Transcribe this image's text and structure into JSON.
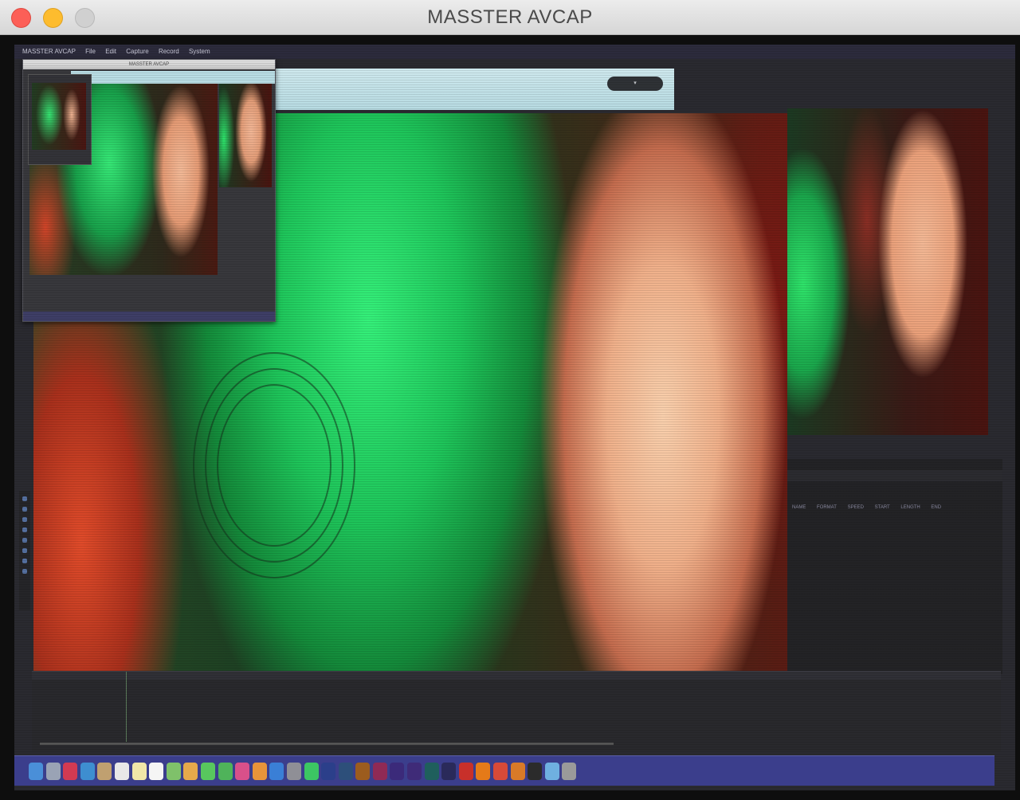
{
  "window": {
    "title": "MASSTER AVCAP"
  },
  "capture": {
    "menu_items": [
      "MASSTER AVCAP",
      "File",
      "Edit",
      "Capture",
      "Record",
      "System"
    ],
    "editor_columns": [
      "NAME",
      "FORMAT",
      "SPEED",
      "START",
      "LENGTH",
      "END"
    ]
  },
  "dock": {
    "icons": [
      "finder-icon",
      "launchpad-icon",
      "safari-icon",
      "mail-icon",
      "contacts-icon",
      "calendar-icon",
      "notes-icon",
      "reminders-icon",
      "maps-icon",
      "photos-icon",
      "messages-icon",
      "facetime-icon",
      "itunes-icon",
      "ibooks-icon",
      "app-store-icon",
      "preferences-icon",
      "spotify-icon",
      "photoshop-icon",
      "lightroom-icon",
      "illustrator-icon",
      "indesign-icon",
      "premiere-icon",
      "after-effects-icon",
      "audition-icon",
      "media-encoder-icon",
      "acrobat-icon",
      "vlc-icon",
      "chrome-icon",
      "firefox-icon",
      "terminal-icon",
      "preview-icon",
      "trash-icon"
    ],
    "colors": [
      "#4a8fd8",
      "#9aa3b5",
      "#d23a52",
      "#3e8ed0",
      "#c0a070",
      "#e8e8e8",
      "#f0e6a8",
      "#f5f5f5",
      "#7fc16a",
      "#e6a94b",
      "#58c75e",
      "#4fb35a",
      "#d9508a",
      "#e7943a",
      "#3a7fd6",
      "#8f8f96",
      "#3cc663",
      "#2b3f8a",
      "#2d4f7a",
      "#9c5c1e",
      "#8f2a55",
      "#3b2a7a",
      "#3f2b78",
      "#1f5f5c",
      "#2a2a5a",
      "#c8302a",
      "#e57a18",
      "#d84a38",
      "#d87a28",
      "#2b2b2b",
      "#6fb0e0",
      "#9a9a9a"
    ]
  }
}
